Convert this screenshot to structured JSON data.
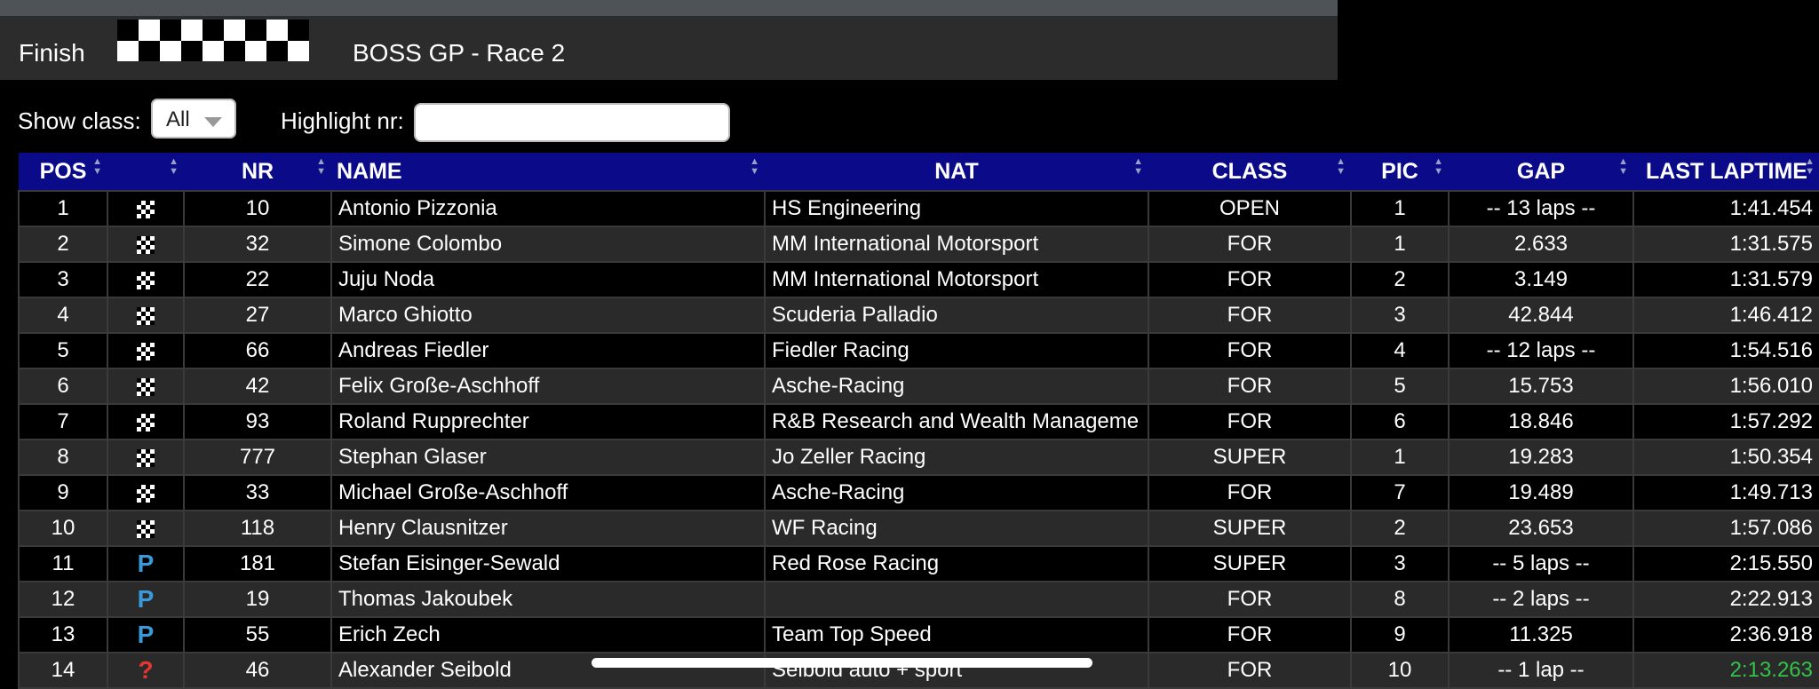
{
  "header": {
    "session_status": "Finish",
    "race_title": "BOSS GP - Race 2"
  },
  "filters": {
    "show_class_label": "Show class:",
    "show_class_value": "All",
    "highlight_label": "Highlight nr:",
    "highlight_value": ""
  },
  "table": {
    "columns": [
      "POS",
      "",
      "NR",
      "NAME",
      "NAT",
      "CLASS",
      "PIC",
      "GAP",
      "LAST LAPTIME"
    ],
    "rows": [
      {
        "pos": "1",
        "status": "flag",
        "nr": "10",
        "name": "Antonio Pizzonia",
        "nat": "HS Engineering",
        "class": "OPEN",
        "pic": "1",
        "gap": "-- 13 laps --",
        "last": "1:41.454"
      },
      {
        "pos": "2",
        "status": "flag",
        "nr": "32",
        "name": "Simone Colombo",
        "nat": "MM International Motorsport",
        "class": "FOR",
        "pic": "1",
        "gap": "2.633",
        "last": "1:31.575"
      },
      {
        "pos": "3",
        "status": "flag",
        "nr": "22",
        "name": "Juju Noda",
        "nat": "MM International Motorsport",
        "class": "FOR",
        "pic": "2",
        "gap": "3.149",
        "last": "1:31.579"
      },
      {
        "pos": "4",
        "status": "flag",
        "nr": "27",
        "name": "Marco Ghiotto",
        "nat": "Scuderia Palladio",
        "class": "FOR",
        "pic": "3",
        "gap": "42.844",
        "last": "1:46.412"
      },
      {
        "pos": "5",
        "status": "flag",
        "nr": "66",
        "name": "Andreas Fiedler",
        "nat": "Fiedler Racing",
        "class": "FOR",
        "pic": "4",
        "gap": "-- 12 laps --",
        "last": "1:54.516"
      },
      {
        "pos": "6",
        "status": "flag",
        "nr": "42",
        "name": "Felix Große-Aschhoff",
        "nat": "Asche-Racing",
        "class": "FOR",
        "pic": "5",
        "gap": "15.753",
        "last": "1:56.010"
      },
      {
        "pos": "7",
        "status": "flag",
        "nr": "93",
        "name": "Roland Rupprechter",
        "nat": "R&B Research and Wealth Manageme",
        "class": "FOR",
        "pic": "6",
        "gap": "18.846",
        "last": "1:57.292"
      },
      {
        "pos": "8",
        "status": "flag",
        "nr": "777",
        "name": "Stephan Glaser",
        "nat": "Jo Zeller Racing",
        "class": "SUPER",
        "pic": "1",
        "gap": "19.283",
        "last": "1:50.354"
      },
      {
        "pos": "9",
        "status": "flag",
        "nr": "33",
        "name": "Michael Große-Aschhoff",
        "nat": "Asche-Racing",
        "class": "FOR",
        "pic": "7",
        "gap": "19.489",
        "last": "1:49.713"
      },
      {
        "pos": "10",
        "status": "flag",
        "nr": "118",
        "name": "Henry Clausnitzer",
        "nat": "WF Racing",
        "class": "SUPER",
        "pic": "2",
        "gap": "23.653",
        "last": "1:57.086"
      },
      {
        "pos": "11",
        "status": "P",
        "nr": "181",
        "name": "Stefan Eisinger-Sewald",
        "nat": "Red Rose Racing",
        "class": "SUPER",
        "pic": "3",
        "gap": "-- 5 laps --",
        "last": "2:15.550"
      },
      {
        "pos": "12",
        "status": "P",
        "nr": "19",
        "name": "Thomas Jakoubek",
        "nat": "",
        "class": "FOR",
        "pic": "8",
        "gap": "-- 2 laps --",
        "last": "2:22.913"
      },
      {
        "pos": "13",
        "status": "P",
        "nr": "55",
        "name": "Erich Zech",
        "nat": "Team Top Speed",
        "class": "FOR",
        "pic": "9",
        "gap": "11.325",
        "last": "2:36.918"
      },
      {
        "pos": "14",
        "status": "?",
        "nr": "46",
        "name": "Alexander Seibold",
        "nat": "Seibold auto + sport",
        "class": "FOR",
        "pic": "10",
        "gap": "-- 1 lap --",
        "last": "2:13.263",
        "last_best": true
      }
    ]
  },
  "colors": {
    "header_bg": "#0b0b8a",
    "best_lap": "#35c24a",
    "pit": "#3a9ad9",
    "unknown": "#e8352f"
  }
}
